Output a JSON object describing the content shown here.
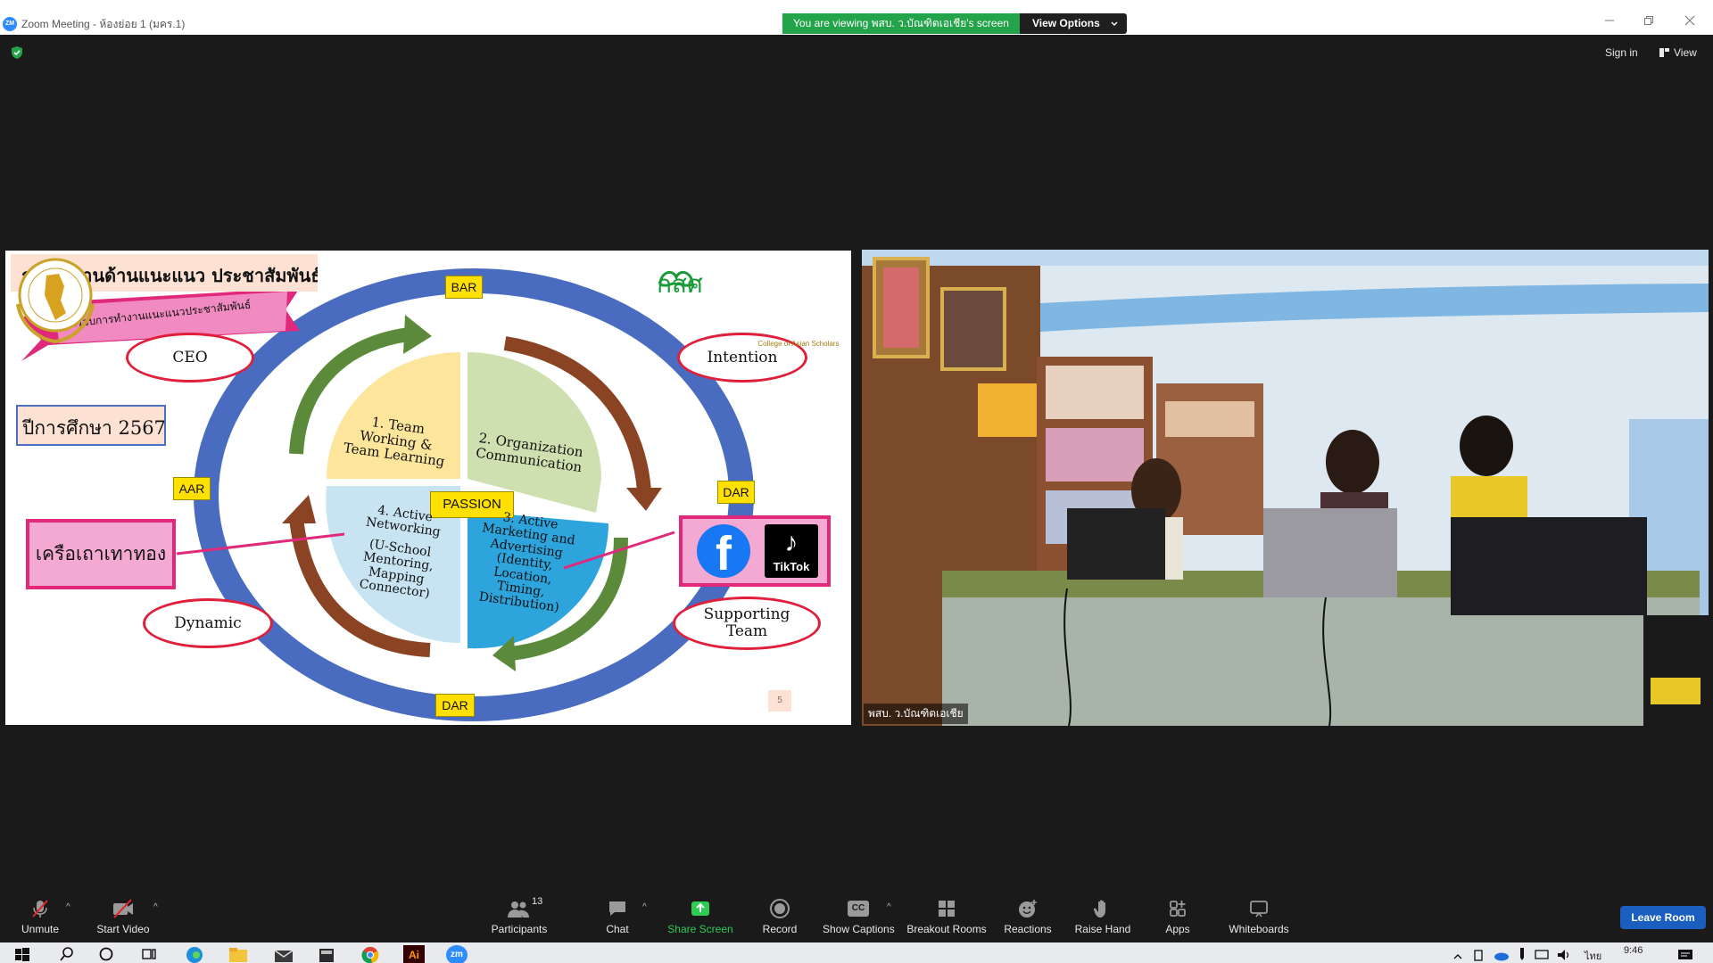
{
  "window": {
    "app_icon": "ZM",
    "title": "Zoom Meeting - ห้องย่อย 1 (มคร.1)",
    "viewing_banner": "You are viewing พสบ. ว.บัณฑิตเอเชีย's screen",
    "view_options_label": "View Options",
    "sign_in_label": "Sign in",
    "view_label": "View"
  },
  "slide": {
    "title": "การทำงานด้านแนะแนว ประชาสัมพันธ์",
    "ribbon_text": "กรอบการทำงานแนะแนวประชาสัมพันธ์",
    "year_label": "ปีการศึกษา 2567",
    "pink_box_label": "เครือเถาเทาทอง",
    "logo_text": "กสศ",
    "seal_text": "College of Asian Scholars",
    "tags": {
      "top": "BAR",
      "left": "AAR",
      "right": "DAR",
      "bottom": "DAR",
      "center": "PASSION"
    },
    "ovals": {
      "ceo": "CEO",
      "intention": "Intention",
      "dynamic": "Dynamic",
      "supporting_line1": "Supporting",
      "supporting_line2": "Team"
    },
    "quadrants": {
      "q1": [
        "1. Team",
        "Working &",
        "Team Learning"
      ],
      "q2": [
        "2. Organization",
        "Communication"
      ],
      "q3": [
        "3. Active",
        "Marketing and",
        "Advertising",
        "(Identity,",
        "Location,",
        "Timing,",
        "Distribution)"
      ],
      "q4": [
        "4. Active",
        "Networking",
        "",
        "(U-School",
        "Mentoring,",
        "Mapping",
        "Connector)"
      ]
    },
    "social": {
      "facebook_glyph": "f",
      "tiktok_label": "TikTok"
    },
    "page_number": "5"
  },
  "video": {
    "participant_name": "พสบ. ว.บัณฑิตเอเชีย"
  },
  "toolbar": {
    "unmute": "Unmute",
    "start_video": "Start Video",
    "participants": "Participants",
    "participants_count": "13",
    "chat": "Chat",
    "share_screen": "Share Screen",
    "record": "Record",
    "show_captions": "Show Captions",
    "captions_badge": "CC",
    "breakout_rooms": "Breakout Rooms",
    "reactions": "Reactions",
    "raise_hand": "Raise Hand",
    "apps": "Apps",
    "whiteboards": "Whiteboards",
    "leave_room": "Leave Room"
  },
  "taskbar": {
    "lang": "ไทย",
    "time": "9:46",
    "pinned_icons": [
      "windows-start-icon",
      "search-icon",
      "cortana-icon",
      "task-view-icon",
      "edge-icon",
      "file-explorer-icon",
      "mail-icon",
      "app-icon",
      "chrome-icon",
      "illustrator-icon",
      "zoom-icon"
    ],
    "illustrator_label": "Ai",
    "zoom_label": "zm"
  },
  "colors": {
    "zoom_blue": "#2d8cff",
    "banner_green": "#23a34a",
    "share_green": "#2ecc52",
    "leave_blue": "#1a5fbf",
    "ring_blue": "#4a6cc0",
    "accent_pink": "#e0297a"
  }
}
